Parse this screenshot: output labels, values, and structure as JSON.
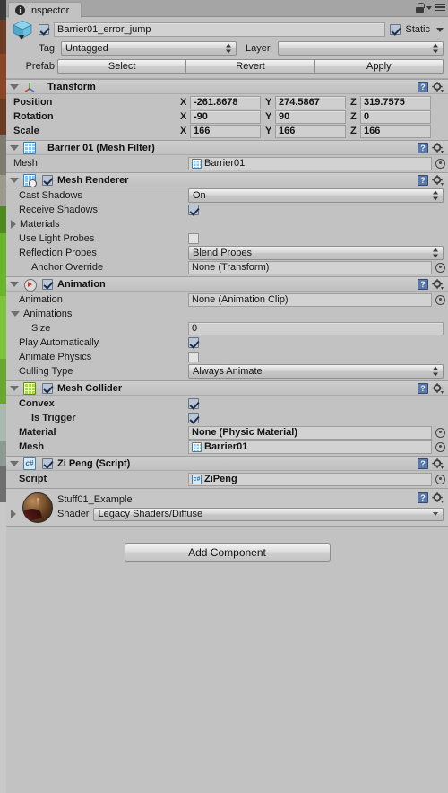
{
  "window": {
    "tab_label": "Inspector",
    "info_glyph": "i",
    "lock_icon": "lock-icon",
    "menu_icon": "hamburger-menu-icon"
  },
  "gameobject": {
    "icon": "cube-prefab-icon",
    "enabled": true,
    "name": "Barrier01_error_jump",
    "static_label": "Static",
    "static_checked": true,
    "tag_label": "Tag",
    "tag_value": "Untagged",
    "layer_label": "Layer",
    "layer_value": "",
    "prefab_label": "Prefab",
    "prefab_buttons": [
      "Select",
      "Revert",
      "Apply"
    ]
  },
  "components": [
    {
      "id": "transform",
      "icon": "transform-gizmo-icon",
      "title": "Transform",
      "has_checkbox": false,
      "bold_props": true,
      "vectors": [
        {
          "label": "Position",
          "x": "-261.8678",
          "y": "274.5867",
          "z": "319.7575"
        },
        {
          "label": "Rotation",
          "x": "-90",
          "y": "90",
          "z": "0"
        },
        {
          "label": "Scale",
          "x": "166",
          "y": "166",
          "z": "166"
        }
      ],
      "axis_labels": [
        "X",
        "Y",
        "Z"
      ]
    },
    {
      "id": "mesh-filter",
      "icon": "mesh-filter-icon",
      "title": "Barrier 01 (Mesh Filter)",
      "has_checkbox": false,
      "props": [
        {
          "type": "object",
          "label": "Mesh",
          "value": "Barrier01",
          "icon": "mesh-icon",
          "bold": false
        }
      ]
    },
    {
      "id": "mesh-renderer",
      "icon": "mesh-renderer-icon",
      "title": "Mesh Renderer",
      "has_checkbox": true,
      "checked": true,
      "props": [
        {
          "type": "dropdown",
          "label": "Cast Shadows",
          "value": "On"
        },
        {
          "type": "checkbox",
          "label": "Receive Shadows",
          "checked": true
        },
        {
          "type": "foldout",
          "label": "Materials",
          "expanded": false
        },
        {
          "type": "checkbox",
          "label": "Use Light Probes",
          "checked": false
        },
        {
          "type": "dropdown",
          "label": "Reflection Probes",
          "value": "Blend Probes"
        },
        {
          "type": "object",
          "label": "Anchor Override",
          "value": "None (Transform)",
          "indent": true
        }
      ]
    },
    {
      "id": "animation",
      "icon": "animation-icon",
      "title": "Animation",
      "has_checkbox": true,
      "checked": true,
      "props": [
        {
          "type": "object",
          "label": "Animation",
          "value": "None (Animation Clip)"
        },
        {
          "type": "foldout",
          "label": "Animations",
          "expanded": true
        },
        {
          "type": "text",
          "label": "Size",
          "value": "0",
          "indent": true
        },
        {
          "type": "checkbox",
          "label": "Play Automatically",
          "checked": true
        },
        {
          "type": "checkbox",
          "label": "Animate Physics",
          "checked": false
        },
        {
          "type": "dropdown",
          "label": "Culling Type",
          "value": "Always Animate"
        }
      ]
    },
    {
      "id": "mesh-collider",
      "icon": "mesh-collider-icon",
      "title": "Mesh Collider",
      "has_checkbox": true,
      "checked": true,
      "bold_props": true,
      "props": [
        {
          "type": "checkbox",
          "label": "Convex",
          "checked": true
        },
        {
          "type": "checkbox",
          "label": "Is Trigger",
          "checked": true,
          "indent": true
        },
        {
          "type": "object",
          "label": "Material",
          "value": "None (Physic Material)"
        },
        {
          "type": "object",
          "label": "Mesh",
          "value": "Barrier01",
          "icon": "mesh-icon"
        }
      ]
    },
    {
      "id": "zi-peng-script",
      "icon": "csharp-script-icon",
      "title": "Zi Peng (Script)",
      "has_checkbox": true,
      "checked": true,
      "bold_props": true,
      "props": [
        {
          "type": "object",
          "label": "Script",
          "value": "ZiPeng",
          "icon": "csharp-script-icon"
        }
      ]
    }
  ],
  "material": {
    "name": "Stuff01_Example",
    "preview_icon": "material-sphere-preview",
    "shader_label": "Shader",
    "shader_value": "Legacy Shaders/Diffuse",
    "expanded": false
  },
  "add_component": {
    "label": "Add Component"
  },
  "header_icons": {
    "help": "?",
    "gear": "gear-icon"
  },
  "colors": {
    "panel_bg": "#c2c2c2",
    "header_bg": "#c6c6c6",
    "field_bg": "#cfcfcf",
    "checkbox_blue": "#b9c6d8",
    "script_blue": "#5d79a8"
  }
}
